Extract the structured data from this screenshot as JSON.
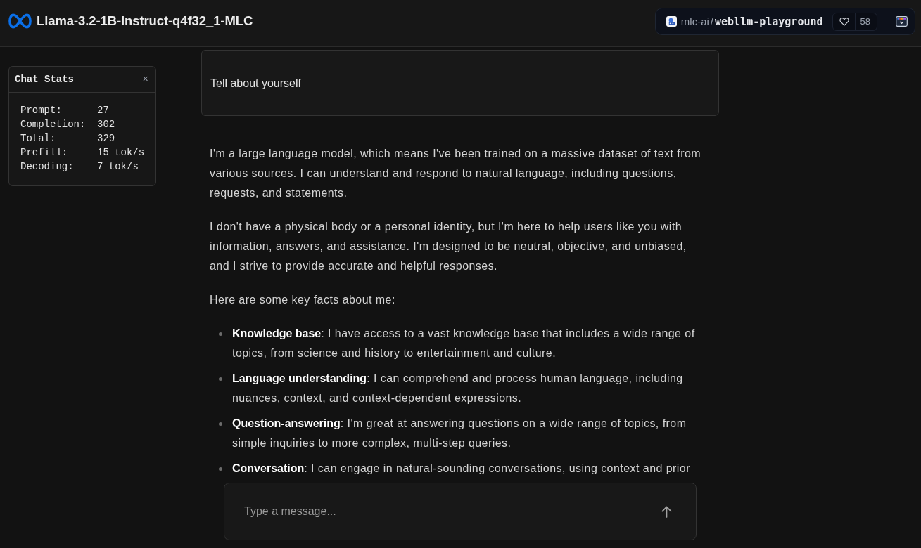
{
  "header": {
    "title": "Llama-3.2-1B-Instruct-q4f32_1-MLC"
  },
  "space_badge": {
    "owner": "mlc-ai",
    "separator": "/",
    "name": "webllm-playground",
    "likes": "58"
  },
  "chat_stats": {
    "title": "Chat Stats",
    "close": "×",
    "rows": [
      {
        "label": "Prompt:",
        "value": "27"
      },
      {
        "label": "Completion:",
        "value": "302"
      },
      {
        "label": "Total:",
        "value": "329"
      },
      {
        "label": "Prefill:",
        "value": "15 tok/s"
      },
      {
        "label": "Decoding:",
        "value": "7 tok/s"
      }
    ]
  },
  "messages": [
    {
      "kind": "prompt",
      "text": "Tell about yourself"
    },
    {
      "kind": "reply",
      "blocks": [
        {
          "kind": "paragraph",
          "text": "I'm a large language model, which means I've been trained on a massive dataset of text from various sources. I can understand and respond to natural language, including questions, requests, and statements."
        },
        {
          "kind": "paragraph",
          "text": "I don't have a physical body or a personal identity, but I'm here to help users like you with information, answers, and assistance. I'm designed to be neutral, objective, and unbiased, and I strive to provide accurate and helpful responses."
        },
        {
          "kind": "paragraph",
          "text": "Here are some key facts about me:"
        },
        {
          "kind": "list",
          "items": [
            "**Knowledge base**: I have access to a vast knowledge base that includes a wide range of topics, from science and history to entertainment and culture.",
            "**Language understanding**: I can comprehend and process human language, including nuances, context, and context-dependent expressions.",
            "**Question-answering**: I'm great at answering questions on a wide range of topics, from simple inquiries to more complex, multi-step queries.",
            "**Conversation**: I can engage in natural-sounding conversations, using context and prior"
          ]
        }
      ]
    }
  ],
  "composer": {
    "placeholder": "Type a message..."
  }
}
